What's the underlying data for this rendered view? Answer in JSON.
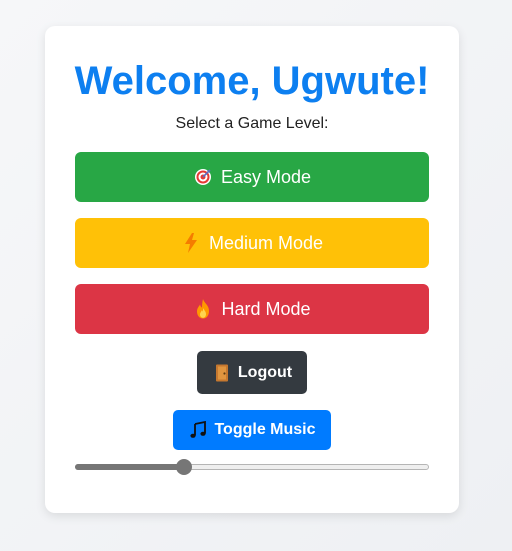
{
  "header": {
    "title": "Welcome, Ugwute!",
    "subtitle": "Select a Game Level:"
  },
  "levels": {
    "easy": {
      "label": "Easy Mode",
      "icon": "target-icon",
      "color": "#28a745"
    },
    "medium": {
      "label": "Medium Mode",
      "icon": "lightning-icon",
      "color": "#ffc107"
    },
    "hard": {
      "label": "Hard Mode",
      "icon": "fire-icon",
      "color": "#dc3545"
    }
  },
  "actions": {
    "logout_label": "Logout",
    "logout_icon": "door-icon",
    "music_label": "Toggle Music",
    "music_icon": "music-note-icon"
  },
  "volume": {
    "value": 0.3
  },
  "colors": {
    "accent": "#0d7ff0",
    "logout_bg": "#343a40",
    "music_bg": "#007bff"
  }
}
